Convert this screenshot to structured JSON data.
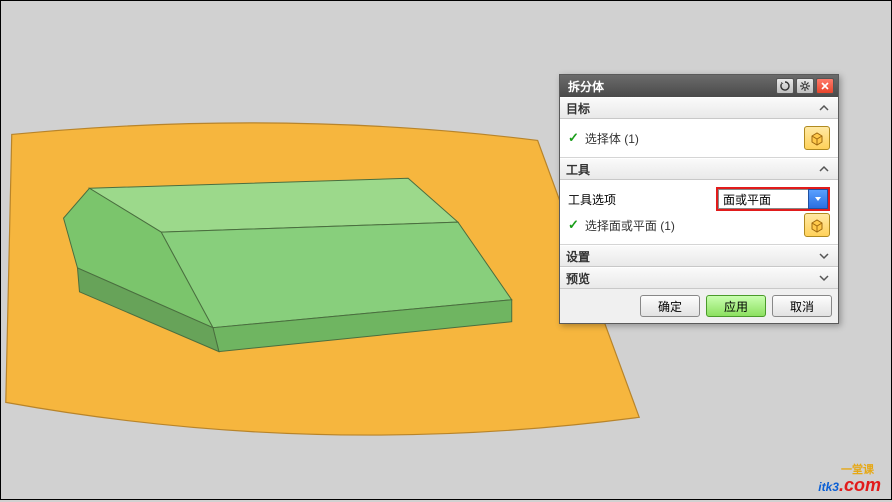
{
  "dialog": {
    "title": "拆分体",
    "sections": {
      "target": {
        "header": "目标",
        "select_body": "选择体 (1)"
      },
      "tool": {
        "header": "工具",
        "option_label": "工具选项",
        "option_value": "面或平面",
        "select_face": "选择面或平面 (1)"
      },
      "settings": {
        "header": "设置"
      },
      "preview": {
        "header": "预览"
      }
    },
    "buttons": {
      "ok": "确定",
      "apply": "应用",
      "cancel": "取消"
    }
  },
  "watermark": {
    "brand": "itk3",
    "tag": "一堂课",
    "domain": ".com"
  },
  "colors": {
    "solid": "#88cf7c",
    "solid_edge": "#4a6e3f",
    "plane": "#f6b63e",
    "plane_edge": "#b8842a"
  }
}
